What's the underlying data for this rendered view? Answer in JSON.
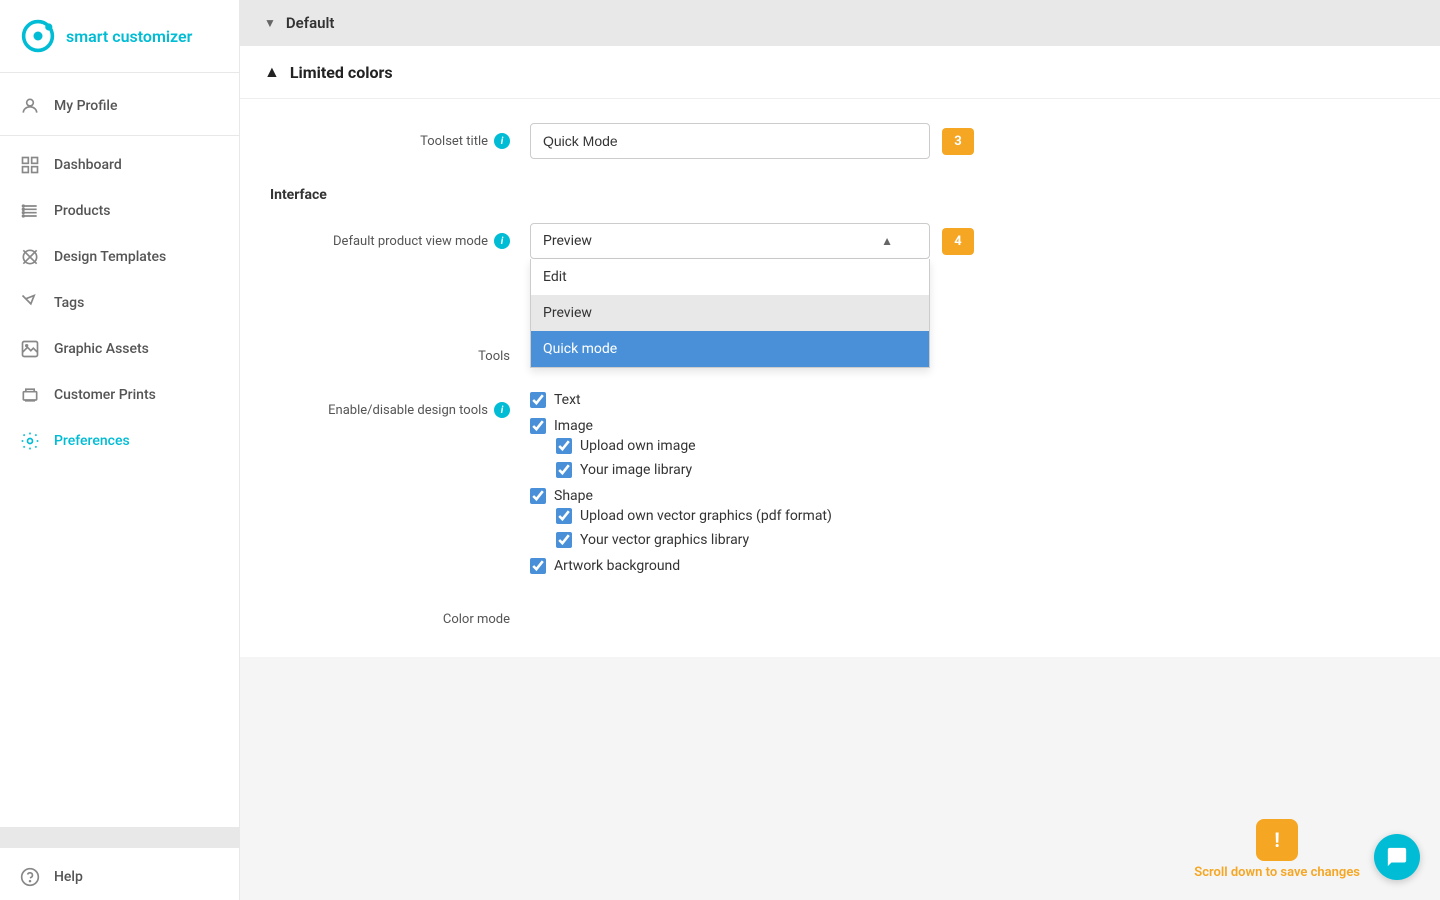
{
  "app": {
    "name": "smart customizer",
    "logo_alt": "Smart Customizer Logo"
  },
  "sidebar": {
    "profile_label": "My Profile",
    "dashboard_label": "Dashboard",
    "products_label": "Products",
    "design_templates_label": "Design Templates",
    "tags_label": "Tags",
    "graphic_assets_label": "Graphic Assets",
    "customer_prints_label": "Customer Prints",
    "preferences_label": "Preferences",
    "help_label": "Help"
  },
  "main": {
    "default_section_label": "Default",
    "limited_colors_label": "Limited colors",
    "toolset_title_label": "Toolset title",
    "toolset_title_value": "Quick Mode",
    "toolset_badge": "3",
    "interface_label": "Interface",
    "default_view_mode_label": "Default product view mode",
    "view_mode_selected": "Preview",
    "view_mode_options": [
      {
        "label": "Edit",
        "value": "edit"
      },
      {
        "label": "Preview",
        "value": "preview"
      },
      {
        "label": "Quick mode",
        "value": "quick_mode"
      }
    ],
    "view_mode_badge": "4",
    "tools_label": "Tools",
    "enable_disable_label": "Enable/disable design tools",
    "tools_checkboxes": [
      {
        "label": "Text",
        "checked": true,
        "children": []
      },
      {
        "label": "Image",
        "checked": true,
        "children": [
          {
            "label": "Upload own image",
            "checked": true
          },
          {
            "label": "Your image library",
            "checked": true
          }
        ]
      },
      {
        "label": "Shape",
        "checked": true,
        "children": [
          {
            "label": "Upload own vector graphics (pdf format)",
            "checked": true
          },
          {
            "label": "Your vector graphics library",
            "checked": true
          }
        ]
      },
      {
        "label": "Artwork background",
        "checked": true,
        "children": []
      }
    ],
    "color_mode_label": "Color mode",
    "scroll_notice": "Scroll down to save changes"
  }
}
